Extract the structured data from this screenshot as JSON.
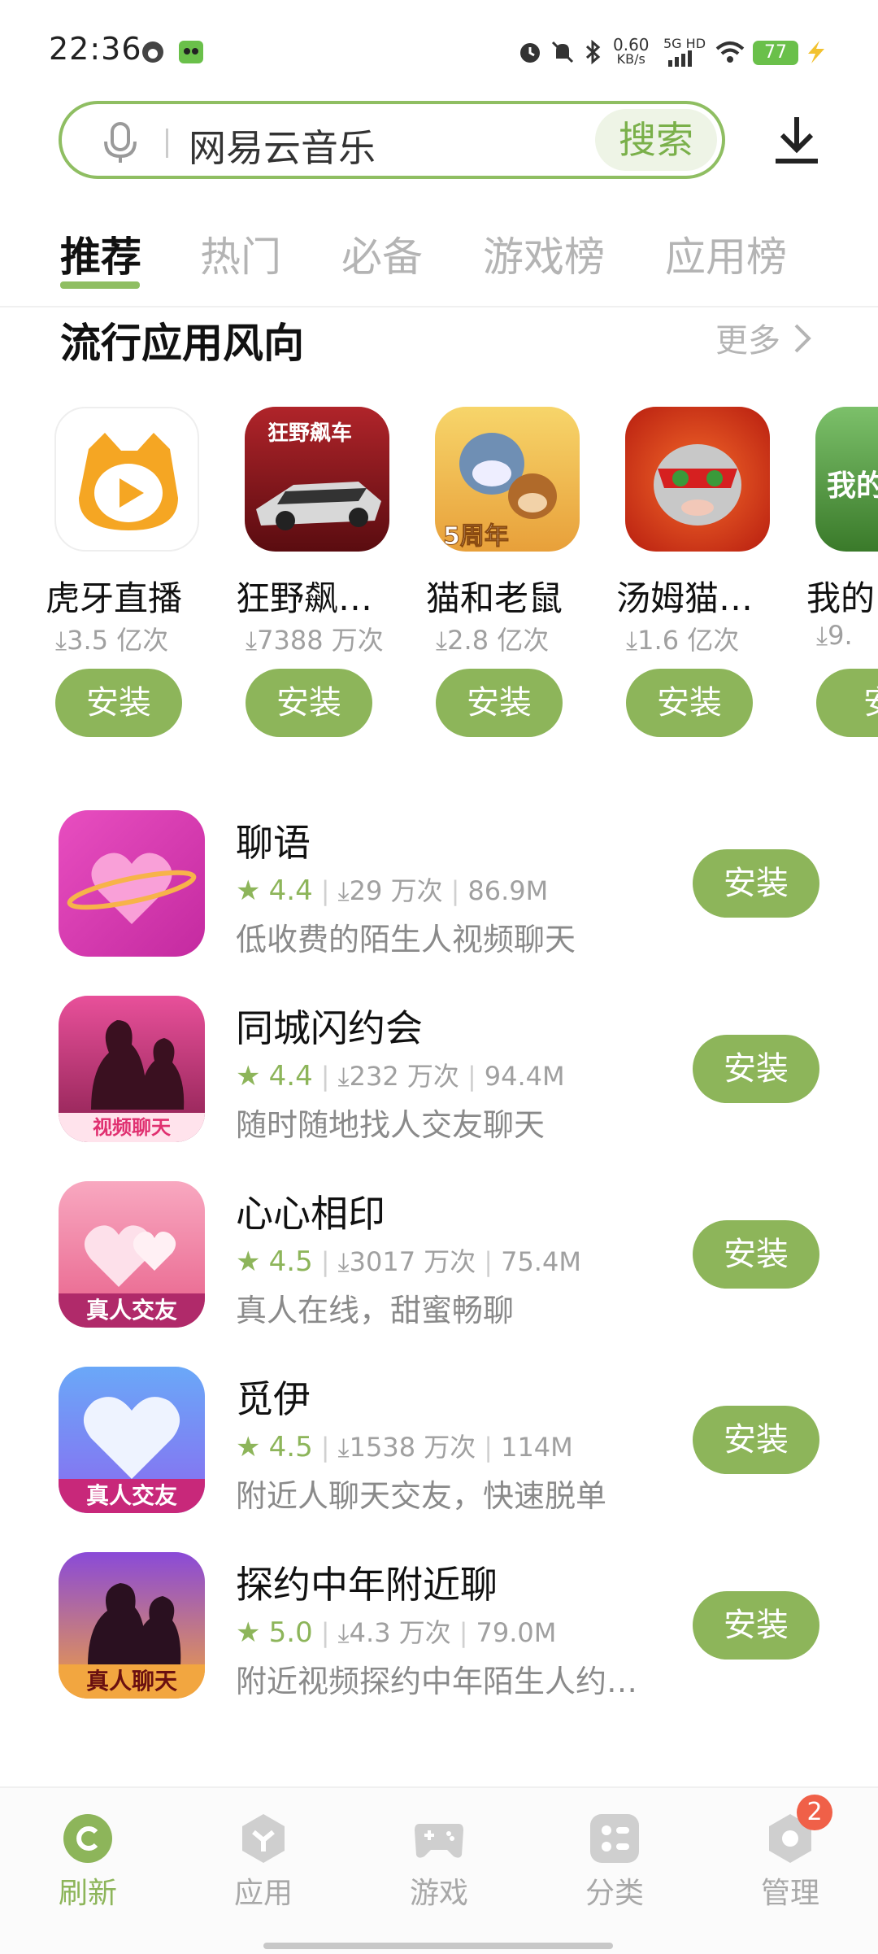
{
  "status_bar": {
    "time": "22:36",
    "speed": "0.60",
    "speed_unit": "KB/s",
    "network": "5G HD",
    "battery": "77"
  },
  "search": {
    "query": "网易云音乐",
    "button_label": "搜索"
  },
  "tabs": [
    {
      "label": "推荐",
      "active": true
    },
    {
      "label": "热门"
    },
    {
      "label": "必备"
    },
    {
      "label": "游戏榜"
    },
    {
      "label": "应用榜"
    }
  ],
  "section": {
    "title": "流行应用风向",
    "more_label": "更多"
  },
  "featured": [
    {
      "name": "虎牙直播",
      "downloads": "3.5 亿次",
      "button": "安装"
    },
    {
      "name": "狂野飙…",
      "downloads": "7388 万次",
      "button": "安装",
      "icon_text": "狂野飙车"
    },
    {
      "name": "猫和老鼠",
      "downloads": "2.8 亿次",
      "button": "安装",
      "icon_text": "5周年"
    },
    {
      "name": "汤姆猫…",
      "downloads": "1.6 亿次",
      "button": "安装"
    },
    {
      "name": "我的",
      "downloads": "9.",
      "button": "安",
      "icon_text": "我的"
    }
  ],
  "apps": [
    {
      "name": "聊语",
      "rating": "4.4",
      "downloads": "29 万次",
      "size": "86.9M",
      "desc": "低收费的陌生人视频聊天",
      "button": "安装"
    },
    {
      "name": "同城闪约会",
      "rating": "4.4",
      "downloads": "232 万次",
      "size": "94.4M",
      "desc": "随时随地找人交友聊天",
      "button": "安装",
      "icon_text": "视频聊天"
    },
    {
      "name": "心心相印",
      "rating": "4.5",
      "downloads": "3017 万次",
      "size": "75.4M",
      "desc": "真人在线，甜蜜畅聊",
      "button": "安装",
      "icon_text": "真人交友"
    },
    {
      "name": "觅伊",
      "rating": "4.5",
      "downloads": "1538 万次",
      "size": "114M",
      "desc": "附近人聊天交友，快速脱单",
      "button": "安装",
      "icon_text": "真人交友"
    },
    {
      "name": "探约中年附近聊",
      "rating": "5.0",
      "downloads": "4.3 万次",
      "size": "79.0M",
      "desc": "附近视频探约中年陌生人约…",
      "button": "安装",
      "icon_text": "真人聊天"
    }
  ],
  "bottom_nav": [
    {
      "label": "刷新",
      "icon": "refresh-icon",
      "active": true
    },
    {
      "label": "应用",
      "icon": "apps-icon"
    },
    {
      "label": "游戏",
      "icon": "gamepad-icon"
    },
    {
      "label": "分类",
      "icon": "category-icon"
    },
    {
      "label": "管理",
      "icon": "manage-icon",
      "badge": "2"
    }
  ],
  "colors": {
    "accent": "#8db55a",
    "badge": "#f06048"
  }
}
